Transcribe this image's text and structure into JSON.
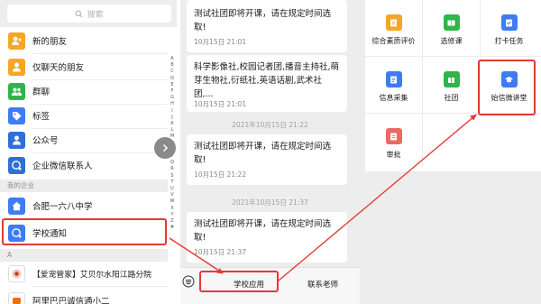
{
  "contacts": {
    "search_placeholder": "搜索",
    "items": [
      {
        "label": "新的朋友",
        "color": "#f5a623"
      },
      {
        "label": "仅聊天的朋友",
        "color": "#f5a623"
      },
      {
        "label": "群聊",
        "color": "#2fb64a"
      },
      {
        "label": "标签",
        "color": "#3d7cf2"
      },
      {
        "label": "公众号",
        "color": "#2e6fd8"
      },
      {
        "label": "企业微信联系人",
        "color": "#2e6fd8"
      }
    ],
    "my_company_header": "我的企业",
    "company_items": [
      {
        "label": "合肥一六八中学",
        "color": "#3d7cf2"
      },
      {
        "label": "学校通知",
        "color": "#3d7cf2"
      }
    ],
    "section_a": "A",
    "a_items": [
      {
        "label": "【爱宠管家】艾贝尔水阳江路分院"
      },
      {
        "label": "阿里巴巴诚信通小二"
      }
    ],
    "alphabet": [
      "A",
      "B",
      "C",
      "D",
      "E",
      "F",
      "G",
      "H",
      "I",
      "J",
      "K",
      "L",
      "M",
      "N",
      "O",
      "P",
      "Q",
      "R",
      "S",
      "T",
      "U",
      "V",
      "W",
      "X",
      "Y",
      "Z",
      "#"
    ]
  },
  "chat": {
    "messages": [
      {
        "text": "测试社团即将开课，请在规定时间选取!",
        "time": "10月15日 21:01"
      },
      {
        "text": "科学影像社,校园记者团,播音主持社,萌芽生物社,衍纸社,英语话剧,武术社团,...",
        "time": "10月15日 21:01"
      },
      {
        "text": "测试社团即将开课，请在规定时间选取!",
        "time": "10月15日 21:22"
      },
      {
        "text": "测试社团即将开课，请在规定时间选取!",
        "time": "10月15日 21:37"
      }
    ],
    "stamps": [
      "2021年10月15日 21:22",
      "2021年10月15日 21:37"
    ],
    "tab_school_apps": "学校应用",
    "tab_contact_teacher": "联系老师"
  },
  "apps": {
    "items": [
      {
        "label": "综合素质评价",
        "color": "#f5a623"
      },
      {
        "label": "选修课",
        "color": "#2fb64a"
      },
      {
        "label": "打卡任务",
        "color": "#3d7cf2"
      },
      {
        "label": "信息采集",
        "color": "#3d7cf2"
      },
      {
        "label": "社团",
        "color": "#2fb64a"
      },
      {
        "label": "始信微讲堂",
        "color": "#3d7cf2"
      },
      {
        "label": "审批",
        "color": "#ec6a5e"
      }
    ]
  }
}
